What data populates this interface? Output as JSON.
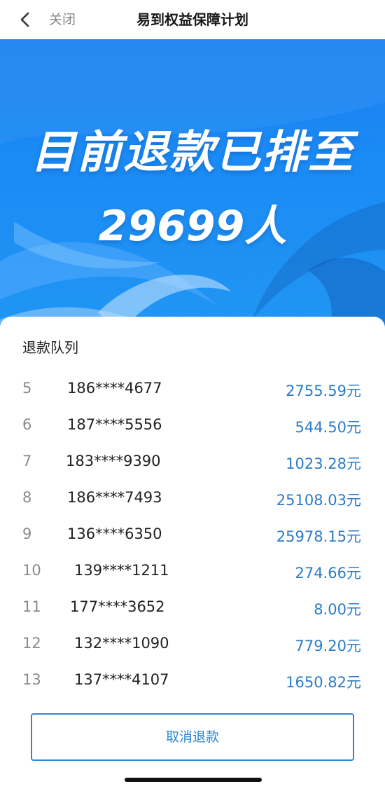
{
  "nav": {
    "close_label": "关闭",
    "title": "易到权益保障计划"
  },
  "banner": {
    "headline": "目前退款已排至",
    "count": "29699人"
  },
  "queue": {
    "title": "退款队列",
    "rows": [
      {
        "index": "5",
        "phone": "186****4677",
        "amount": "2755.59元"
      },
      {
        "index": "6",
        "phone": "187****5556",
        "amount": "544.50元"
      },
      {
        "index": "7",
        "phone": "183****9390",
        "amount": "1023.28元"
      },
      {
        "index": "8",
        "phone": "186****7493",
        "amount": "25108.03元"
      },
      {
        "index": "9",
        "phone": "136****6350",
        "amount": "25978.15元"
      },
      {
        "index": "10",
        "phone": "139****1211",
        "amount": "274.66元"
      },
      {
        "index": "11",
        "phone": "177****3652",
        "amount": "8.00元"
      },
      {
        "index": "12",
        "phone": "132****1090",
        "amount": "779.20元"
      },
      {
        "index": "13",
        "phone": "137****4107",
        "amount": "1650.82元"
      }
    ]
  },
  "actions": {
    "cancel_label": "取消退款"
  },
  "colors": {
    "banner_blue": "#1a8af4",
    "amount_blue": "#2b7cc7",
    "button_border": "#2f86d4"
  }
}
